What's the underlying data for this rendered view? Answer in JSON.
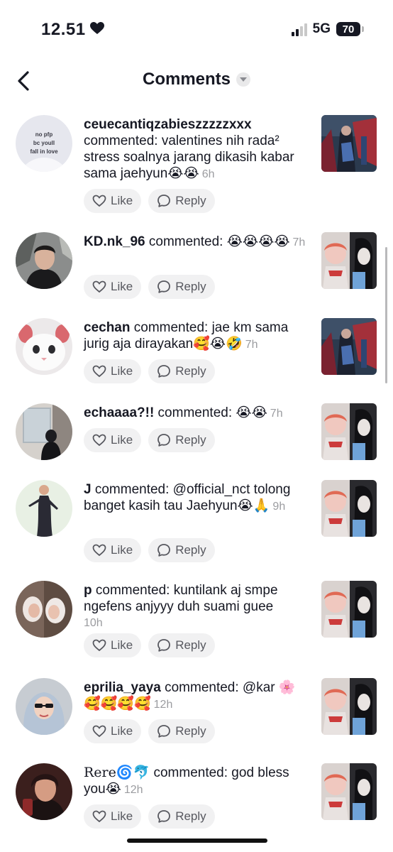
{
  "status_bar": {
    "time": "12.51",
    "heart_icon": "heart-icon",
    "network": "5G",
    "battery": "70"
  },
  "header": {
    "title": "Comments"
  },
  "actions": {
    "like_label": "Like",
    "reply_label": "Reply"
  },
  "comments": [
    {
      "username": "ceuecantiqzabieszzzzzxxx",
      "text": " commented: valentines nih rada² stress soalnya jarang dikasih kabar sama jaehyun😭😭",
      "time": "6h",
      "avatar_text": "no pfp bc youll fall in love"
    },
    {
      "username": "KD.nk_96",
      "text": " commented: 😭😭😭😭",
      "time": "7h"
    },
    {
      "username": "cechan",
      "text": " commented: jae km sama jurig aja dirayakan🥰😭🤣",
      "time": "7h"
    },
    {
      "username": "echaaaa?!!",
      "text": " commented: 😭😭",
      "time": "7h"
    },
    {
      "username": "J",
      "text": " commented: @official_nct tolong banget kasih tau Jaehyun😭🙏",
      "time": "9h"
    },
    {
      "username": "p",
      "text": " commented: kuntilank aj smpe ngefens anjyyy duh suami guee",
      "time": "10h"
    },
    {
      "username": "eprilia_yaya",
      "text": " commented: @kar 🌸🥰🥰🥰🥰",
      "time": "12h"
    },
    {
      "username": "Rere🌀🐬",
      "text": " commented: god bless you😭",
      "time": "12h"
    }
  ]
}
